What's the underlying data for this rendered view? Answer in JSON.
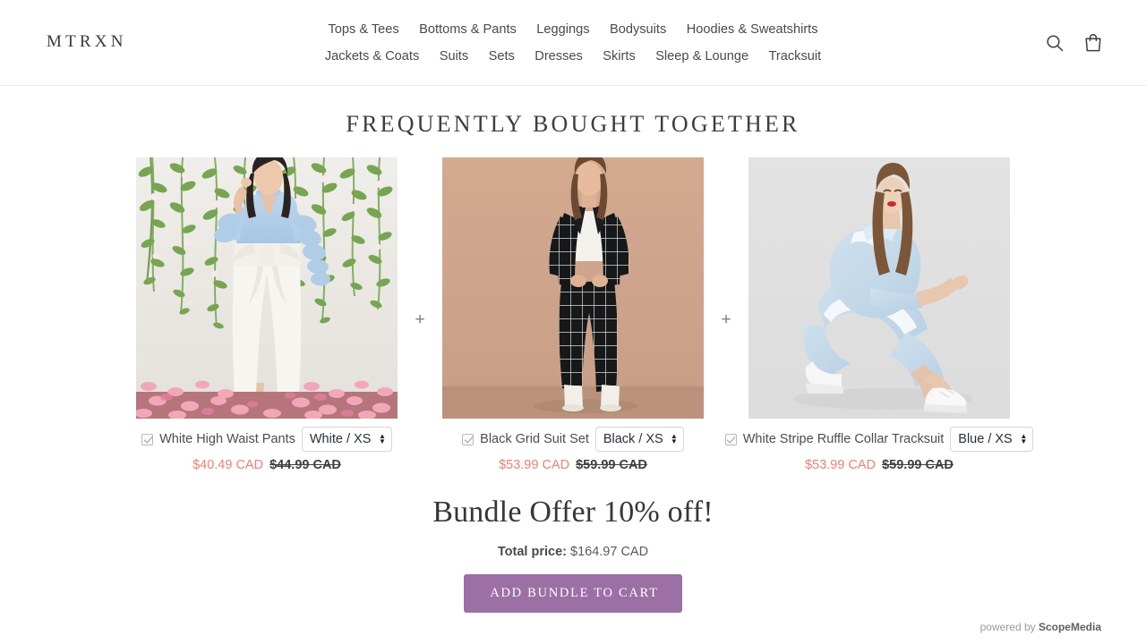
{
  "header": {
    "brand": "MTRXN",
    "nav_row1": [
      {
        "label": "Tops & Tees"
      },
      {
        "label": "Bottoms & Pants"
      },
      {
        "label": "Leggings"
      },
      {
        "label": "Bodysuits"
      },
      {
        "label": "Hoodies & Sweatshirts"
      }
    ],
    "nav_row2": [
      {
        "label": "Jackets & Coats"
      },
      {
        "label": "Suits"
      },
      {
        "label": "Sets"
      },
      {
        "label": "Dresses"
      },
      {
        "label": "Skirts"
      },
      {
        "label": "Sleep & Lounge"
      },
      {
        "label": "Tracksuit"
      }
    ],
    "icons": {
      "search": "search-icon",
      "cart": "shopping-bag-icon"
    }
  },
  "section": {
    "title": "FREQUENTLY BOUGHT TOGETHER",
    "separator": "+"
  },
  "products": [
    {
      "name": "White High Waist Pants",
      "checked": true,
      "variant": "White / XS",
      "variant_options": [
        "White / XS"
      ],
      "sale_price": "$40.49 CAD",
      "original_price": "$44.99 CAD",
      "image_alt": "Model in light blue ruffle sleeve blouse and white high waist pants in front of white wall with hanging green vines and pink petals"
    },
    {
      "name": "Black Grid Suit Set",
      "checked": true,
      "variant": "Black / XS",
      "variant_options": [
        "Black / XS"
      ],
      "sale_price": "$53.99 CAD",
      "original_price": "$59.99 CAD",
      "image_alt": "Model in black windowpane grid blazer and trousers with white top and white boots on tan background"
    },
    {
      "name": "White Stripe Ruffle Collar Tracksuit",
      "checked": true,
      "variant": "Blue / XS",
      "variant_options": [
        "Blue / XS"
      ],
      "sale_price": "$53.99 CAD",
      "original_price": "$59.99 CAD",
      "image_alt": "Model crouching in light blue tracksuit with white side stripe and white sneakers on light grey background"
    }
  ],
  "offer": {
    "headline": "Bundle Offer 10% off!",
    "total_label": "Total price:",
    "total_value": "$164.97 CAD",
    "cta_label": "ADD BUNDLE TO CART"
  },
  "footer": {
    "powered_prefix": "powered by ",
    "powered_brand": "ScopeMedia"
  },
  "colors": {
    "accent_button": "#9c6fa5",
    "sale_price": "#e88272",
    "text": "#4a4a4a",
    "border": "#ececec"
  }
}
